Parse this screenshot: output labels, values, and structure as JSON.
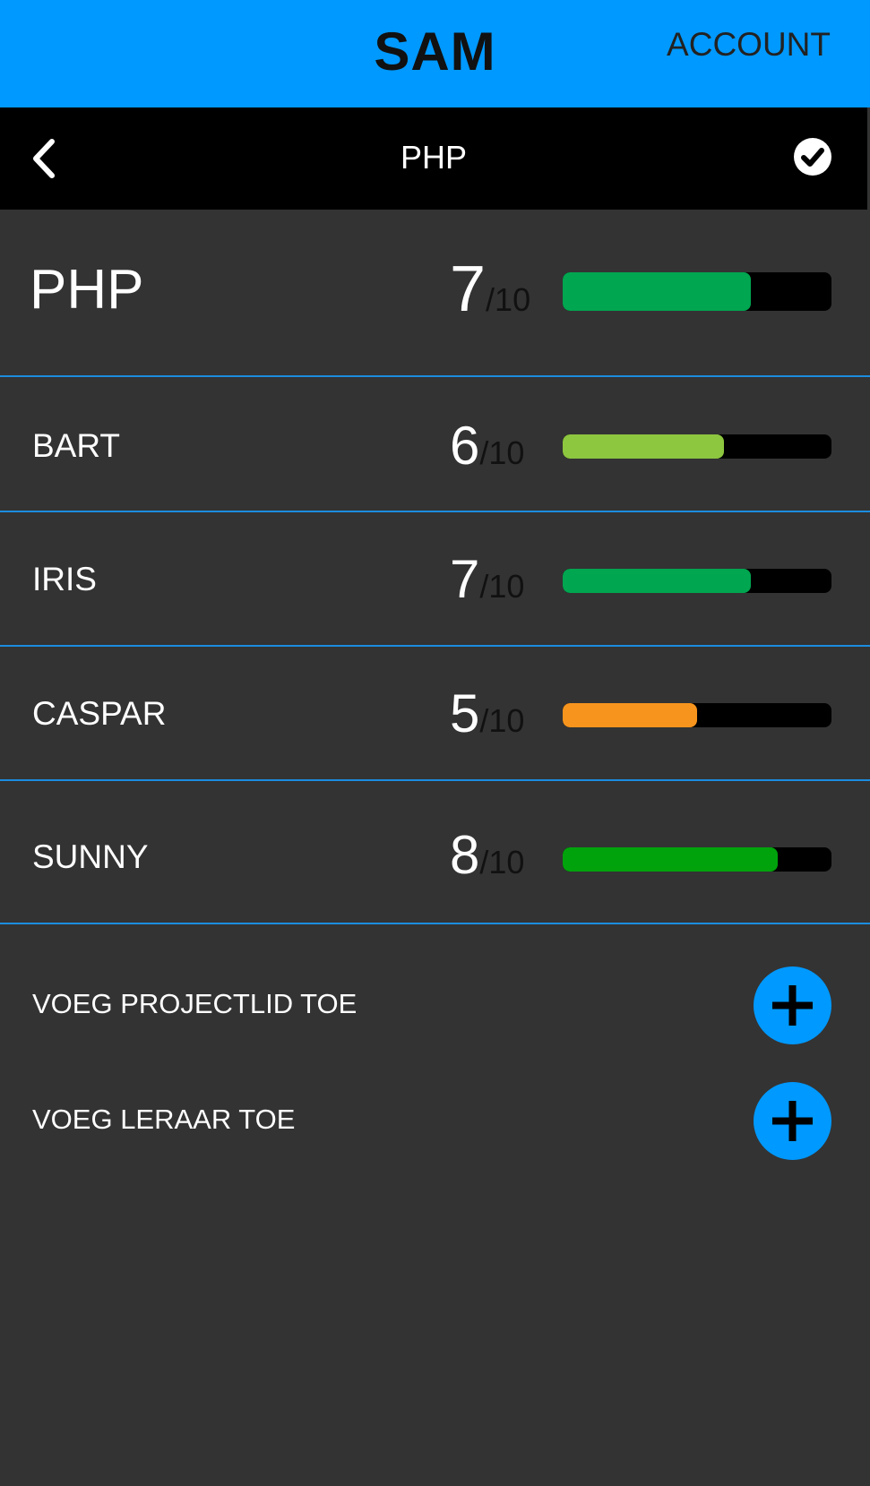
{
  "header": {
    "app_title": "SAM",
    "account_label": "ACCOUNT",
    "accent_color": "#0099ff"
  },
  "subheader": {
    "title": "PHP",
    "back_icon": "chevron-left-icon",
    "confirm_icon": "check-circle-icon"
  },
  "summary": {
    "name": "PHP",
    "score": "7",
    "max": "/10",
    "fraction": 0.7,
    "color": "#00a650"
  },
  "members": [
    {
      "name": "BART",
      "score": "6",
      "max": "/10",
      "fraction": 0.6,
      "color": "#8dc63f"
    },
    {
      "name": "IRIS",
      "score": "7",
      "max": "/10",
      "fraction": 0.7,
      "color": "#00a650"
    },
    {
      "name": "CASPAR",
      "score": "5",
      "max": "/10",
      "fraction": 0.5,
      "color": "#f7941d"
    },
    {
      "name": "SUNNY",
      "score": "8",
      "max": "/10",
      "fraction": 0.8,
      "color": "#00a30c"
    }
  ],
  "actions": {
    "add_member_label": "VOEG PROJECTLID TOE",
    "add_teacher_label": "VOEG LERAAR TOE",
    "add_icon": "plus-icon"
  }
}
